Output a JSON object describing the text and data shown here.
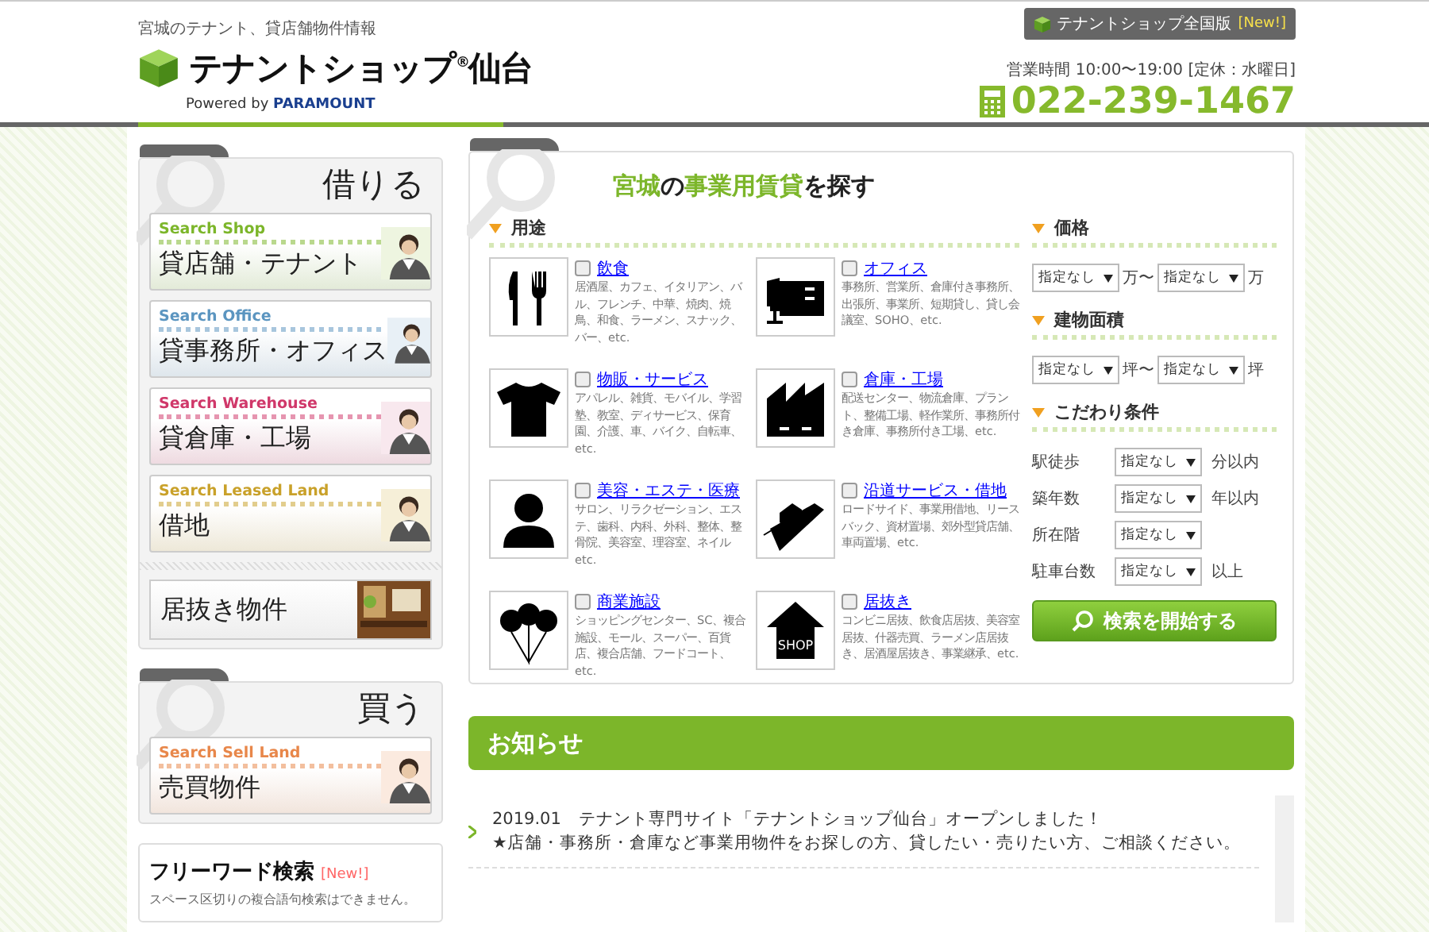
{
  "header": {
    "tagline": "宮城のテナント、貸店舗物件情報",
    "logo": "テナントショップ$^{®}$仙台",
    "powered_by": "Powered by",
    "brand": "PARAMOUNT",
    "national_link": "テナントショップ全国版",
    "national_badge": "[New!]",
    "hours": "営業時間 10:00〜19:00 [定休：水曜日]",
    "phone": "022-239-1467"
  },
  "sidebar": {
    "rent": {
      "title": "借りる",
      "items": [
        {
          "subtitle": "Search Shop",
          "label": "貸店舗・テナント",
          "color": "#7cb62a"
        },
        {
          "subtitle": "Search Office",
          "label": "貸事務所・オフィス",
          "color": "#5b95c0"
        },
        {
          "subtitle": "Search Warehouse",
          "label": "貸倉庫・工場",
          "color": "#d0386a"
        },
        {
          "subtitle": "Search Leased Land",
          "label": "借地",
          "color": "#c9a12a"
        }
      ],
      "extra": "居抜き物件"
    },
    "buy": {
      "title": "買う",
      "items": [
        {
          "subtitle": "Search Sell Land",
          "label": "売買物件",
          "color": "#e8874a"
        }
      ]
    },
    "free_word": {
      "title": "フリーワード検索",
      "badge": "[New!]",
      "note": "スペース区切りの複合語句検索はできません。"
    }
  },
  "search": {
    "title": "**宮城**の**事業用賃貸**を探す",
    "usage_heading": "用途",
    "categories": [
      {
        "name": "飲食",
        "checked": false,
        "desc": "居酒屋、カフェ、イタリアン、バル、フレンチ、中華、焼肉、焼鳥、和食、ラーメン、スナック、バー、etc."
      },
      {
        "name": "オフィス",
        "checked": false,
        "desc": "事務所、営業所、倉庫付き事務所、出張所、事業所、短期貸し、貸し会議室、SOHO、etc."
      },
      {
        "name": "物販・サービス",
        "checked": false,
        "desc": "アパレル、雑貨、モバイル、学習塾、教室、ディサービス、保育園、介護、車、バイク、自転車、etc."
      },
      {
        "name": "倉庫・工場",
        "checked": false,
        "desc": "配送センター、物流倉庫、プラント、整備工場、軽作業所、事務所付き倉庫、事務所付き工場、etc."
      },
      {
        "name": "美容・エステ・医療",
        "checked": false,
        "desc": "サロン、リラクゼーション、エステ、歯科、内科、外科、整体、整骨院、美容室、理容室、ネイル etc."
      },
      {
        "name": "沿道サービス・借地",
        "checked": false,
        "desc": "ロードサイド、事業用借地、リースバック、資材置場、郊外型貸店舗、車両置場、etc."
      },
      {
        "name": "商業施設",
        "checked": false,
        "desc": "ショッピングセンター、SC、複合施設、モール、スーパー、百貨店、複合店舗、フードコート、etc."
      },
      {
        "name": "居抜き",
        "checked": false,
        "desc": "コンビニ居抜、飲食店居抜、美容室居抜、什器売買、ラーメン店居抜き、居酒屋居抜き、事業継承、etc.",
        "icon_label": "SHOP"
      }
    ],
    "price": {
      "heading": "価格",
      "from": "指定なし",
      "from_unit": "万〜",
      "to": "指定なし",
      "to_unit": "万"
    },
    "area": {
      "heading": "建物面積",
      "from": "指定なし",
      "from_unit": "坪〜",
      "to": "指定なし",
      "to_unit": "坪"
    },
    "conditions": {
      "heading": "こだわり条件",
      "rows": [
        {
          "label": "駅徒歩",
          "value": "指定なし",
          "unit": "分以内"
        },
        {
          "label": "築年数",
          "value": "指定なし",
          "unit": "年以内"
        },
        {
          "label": "所在階",
          "value": "指定なし"
        },
        {
          "label": "駐車台数",
          "value": "指定なし",
          "unit": "以上"
        }
      ]
    },
    "button": "検索を開始する"
  },
  "news": {
    "title": "お知らせ",
    "items": [
      {
        "date": "2019.01",
        "text": "テナント専門サイト「テナントショップ仙台」オープンしました！",
        "detail": "★店舗・事務所・倉庫など事業用物件をお探しの方、貸したい・売りたい方、ご相談ください。"
      }
    ]
  }
}
